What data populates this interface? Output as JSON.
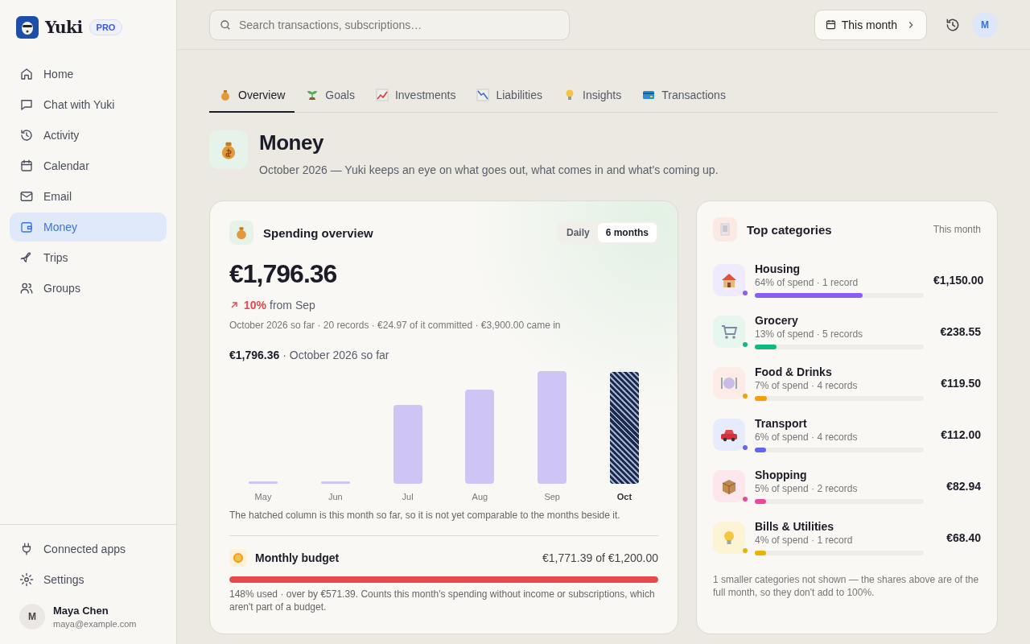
{
  "brand": {
    "name": "Yuki",
    "badge": "PRO"
  },
  "nav": [
    {
      "label": "Home",
      "selected": false
    },
    {
      "label": "Chat with Yuki",
      "selected": false
    },
    {
      "label": "Activity",
      "selected": false
    },
    {
      "label": "Calendar",
      "selected": false
    },
    {
      "label": "Email",
      "selected": false
    },
    {
      "label": "Money",
      "selected": true
    },
    {
      "label": "Trips",
      "selected": false
    },
    {
      "label": "Groups",
      "selected": false
    }
  ],
  "nav_bottom": [
    {
      "label": "Connected apps"
    },
    {
      "label": "Settings"
    }
  ],
  "user": {
    "initial": "M",
    "name": "Maya Chen",
    "email": "maya@example.com"
  },
  "search": {
    "placeholder": "Search transactions, subscriptions…"
  },
  "period_button": "This month",
  "top_avatar": "M",
  "tabs": [
    {
      "label": "Overview",
      "selected": true
    },
    {
      "label": "Goals",
      "selected": false
    },
    {
      "label": "Investments",
      "selected": false
    },
    {
      "label": "Liabilities",
      "selected": false
    },
    {
      "label": "Insights",
      "selected": false
    },
    {
      "label": "Transactions",
      "selected": false
    }
  ],
  "page": {
    "title": "Money",
    "subtitle": "October 2026 — Yuki keeps an eye on what goes out, what comes in and what's coming up."
  },
  "spending": {
    "title": "Spending overview",
    "toggle": [
      {
        "label": "Daily",
        "selected": false
      },
      {
        "label": "6 months",
        "selected": true
      }
    ],
    "total": "€1,796.36",
    "change": "10%",
    "change_suffix": "from Sep",
    "meta": "October 2026 so far · 20 records · €24.97 of it committed · €3,900.00 came in",
    "chart_caption": "**€1,796.36** · October 2026 so far",
    "months": [
      {
        "label": "May",
        "current": false
      },
      {
        "label": "Jun",
        "current": false
      },
      {
        "label": "Jul",
        "current": false
      },
      {
        "label": "Aug",
        "current": false
      },
      {
        "label": "Sep",
        "current": false
      },
      {
        "label": "Oct",
        "current": true
      }
    ],
    "chart_note": "The hatched column is this month so far, so it is not yet comparable to the months beside it.",
    "budget": {
      "title": "Monthly budget",
      "amount": "€1,771.39 of €1,200.00",
      "level": 1,
      "note": "148% used · over by €571.39. Counts this month's spending without income or subscriptions, which aren't part of a budget."
    }
  },
  "categories": {
    "title": "Top categories",
    "period": "This month",
    "items": [
      {
        "name": "Housing",
        "detail": "64% of spend · 1 record",
        "amount": "€1,150.00",
        "level": 0.64,
        "color": "#8b5cf6"
      },
      {
        "name": "Grocery",
        "detail": "13% of spend · 5 records",
        "amount": "€238.55",
        "level": 0.13,
        "color": "#10b981"
      },
      {
        "name": "Food & Drinks",
        "detail": "7% of spend · 4 records",
        "amount": "€119.50",
        "level": 0.07,
        "color": "#f59e0b"
      },
      {
        "name": "Transport",
        "detail": "6% of spend · 4 records",
        "amount": "€112.00",
        "level": 0.06,
        "color": "#6366f1"
      },
      {
        "name": "Shopping",
        "detail": "5% of spend · 2 records",
        "amount": "€82.94",
        "level": 0.05,
        "color": "#ec4899"
      },
      {
        "name": "Bills & Utilities",
        "detail": "4% of spend · 1 record",
        "amount": "€68.40",
        "level": 0.04,
        "color": "#eab308"
      }
    ],
    "note": "1 smaller categories not shown — the shares above are of the full month, so they don't add to 100%."
  }
}
